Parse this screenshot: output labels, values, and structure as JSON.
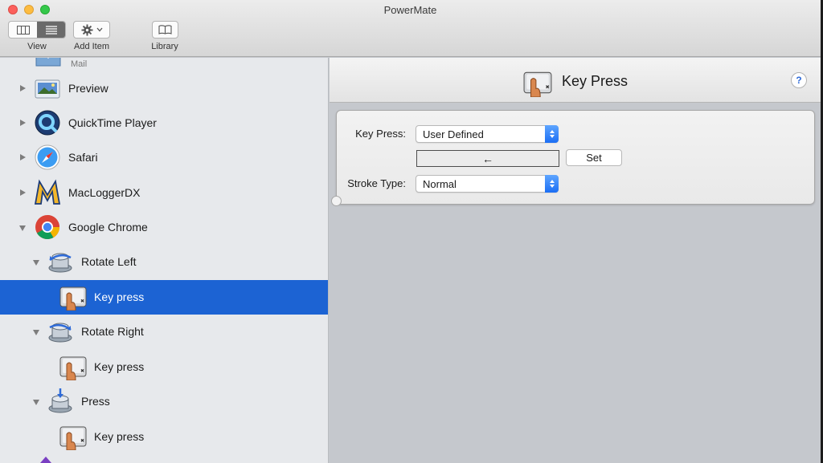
{
  "window": {
    "title": "PowerMate"
  },
  "toolbar": {
    "view_label": "View",
    "add_item_label": "Add Item",
    "library_label": "Library"
  },
  "sidebar": {
    "partial_top_label": "Mail",
    "items": [
      {
        "label": "Preview",
        "icon": "preview-icon",
        "expanded": false
      },
      {
        "label": "QuickTime Player",
        "icon": "quicktime-icon",
        "expanded": false
      },
      {
        "label": "Safari",
        "icon": "safari-icon",
        "expanded": false
      },
      {
        "label": "MacLoggerDX",
        "icon": "macloggerdx-icon",
        "expanded": false
      },
      {
        "label": "Google Chrome",
        "icon": "chrome-icon",
        "expanded": true
      },
      {
        "label": "Rotate Left",
        "icon": "rotate-left-icon",
        "expanded": true
      },
      {
        "label": "Key press",
        "icon": "key-press-icon",
        "selected": true
      },
      {
        "label": "Rotate Right",
        "icon": "rotate-right-icon",
        "expanded": true
      },
      {
        "label": "Key press",
        "icon": "key-press-icon"
      },
      {
        "label": "Press",
        "icon": "press-icon",
        "expanded": true
      },
      {
        "label": "Key press",
        "icon": "key-press-icon"
      }
    ]
  },
  "main": {
    "header_title": "Key Press",
    "help_label": "?",
    "form": {
      "key_press_label": "Key Press:",
      "key_press_value": "User Defined",
      "key_value": "←",
      "set_label": "Set",
      "stroke_type_label": "Stroke Type:",
      "stroke_type_value": "Normal"
    }
  },
  "colors": {
    "selection": "#1c63d3",
    "accent": "#1b6ef4"
  }
}
